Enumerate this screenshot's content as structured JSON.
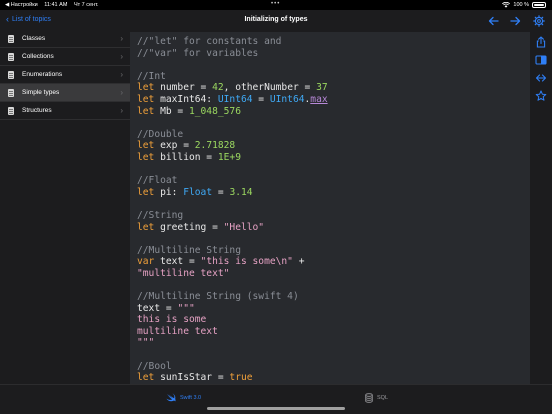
{
  "status_bar": {
    "carrier": "◀ Настройки",
    "time": "11:41 AM",
    "date": "Чт 7 сент.",
    "dots": "•••",
    "battery": "100 %"
  },
  "sidebar": {
    "back_label": "List of topics",
    "items": [
      {
        "label": "Classes"
      },
      {
        "label": "Collections"
      },
      {
        "label": "Enumerations"
      },
      {
        "label": "Simple types"
      },
      {
        "label": "Structures"
      }
    ]
  },
  "topbar": {
    "title": "Initializing of types"
  },
  "code_lines": [
    [
      {
        "t": "cmt",
        "v": "//\"let\" for constants and"
      }
    ],
    [
      {
        "t": "cmt",
        "v": "//\"var\" for variables"
      }
    ],
    [],
    [
      {
        "t": "cmt",
        "v": "//Int"
      }
    ],
    [
      {
        "t": "kw",
        "v": "let"
      },
      {
        "t": "",
        "v": " number = "
      },
      {
        "t": "num",
        "v": "42"
      },
      {
        "t": "",
        "v": ", otherNumber = "
      },
      {
        "t": "num",
        "v": "37"
      }
    ],
    [
      {
        "t": "kw",
        "v": "let"
      },
      {
        "t": "",
        "v": " maxInt64: "
      },
      {
        "t": "typ",
        "v": "UInt64"
      },
      {
        "t": "",
        "v": " = "
      },
      {
        "t": "typ",
        "v": "UInt64"
      },
      {
        "t": "",
        "v": "."
      },
      {
        "t": "prop",
        "v": "max"
      }
    ],
    [
      {
        "t": "kw",
        "v": "let"
      },
      {
        "t": "",
        "v": " Mb = "
      },
      {
        "t": "num",
        "v": "1_048_576"
      }
    ],
    [],
    [
      {
        "t": "cmt",
        "v": "//Double"
      }
    ],
    [
      {
        "t": "kw",
        "v": "let"
      },
      {
        "t": "",
        "v": " exp = "
      },
      {
        "t": "num",
        "v": "2.71828"
      }
    ],
    [
      {
        "t": "kw",
        "v": "let"
      },
      {
        "t": "",
        "v": " billion = "
      },
      {
        "t": "num",
        "v": "1E+9"
      }
    ],
    [],
    [
      {
        "t": "cmt",
        "v": "//Float"
      }
    ],
    [
      {
        "t": "kw",
        "v": "let"
      },
      {
        "t": "",
        "v": " pi: "
      },
      {
        "t": "typ",
        "v": "Float"
      },
      {
        "t": "",
        "v": " = "
      },
      {
        "t": "num",
        "v": "3.14"
      }
    ],
    [],
    [
      {
        "t": "cmt",
        "v": "//String"
      }
    ],
    [
      {
        "t": "kw",
        "v": "let"
      },
      {
        "t": "",
        "v": " greeting = "
      },
      {
        "t": "str",
        "v": "\"Hello\""
      }
    ],
    [],
    [
      {
        "t": "cmt",
        "v": "//Multiline String"
      }
    ],
    [
      {
        "t": "kw",
        "v": "var"
      },
      {
        "t": "",
        "v": " text = "
      },
      {
        "t": "str",
        "v": "\"this is some\\n\""
      },
      {
        "t": "",
        "v": " +"
      }
    ],
    [
      {
        "t": "str",
        "v": "\"multiline text\""
      }
    ],
    [],
    [
      {
        "t": "cmt",
        "v": "//Multiline String (swift 4)"
      }
    ],
    [
      {
        "t": "",
        "v": "text = "
      },
      {
        "t": "str",
        "v": "\"\"\""
      }
    ],
    [
      {
        "t": "str",
        "v": "this is some"
      }
    ],
    [
      {
        "t": "str",
        "v": "multiline text"
      }
    ],
    [
      {
        "t": "str",
        "v": "\"\"\""
      }
    ],
    [],
    [
      {
        "t": "cmt",
        "v": "//Bool"
      }
    ],
    [
      {
        "t": "kw",
        "v": "let"
      },
      {
        "t": "",
        "v": " sunIsStar = "
      },
      {
        "t": "kw",
        "v": "true"
      }
    ]
  ],
  "tabbar": {
    "tabs": [
      {
        "label": "Swift 3.0",
        "active": true,
        "icon": "swift-icon"
      },
      {
        "label": "SQL",
        "active": false,
        "icon": "database-icon"
      }
    ]
  },
  "colors": {
    "accent": "#2f7ff6",
    "keyword": "#f0a03a",
    "number": "#9bd860",
    "type": "#3fa9f5",
    "string": "#e6a2c4",
    "comment": "#8a8e96",
    "editor_bg": "#282a2e"
  }
}
